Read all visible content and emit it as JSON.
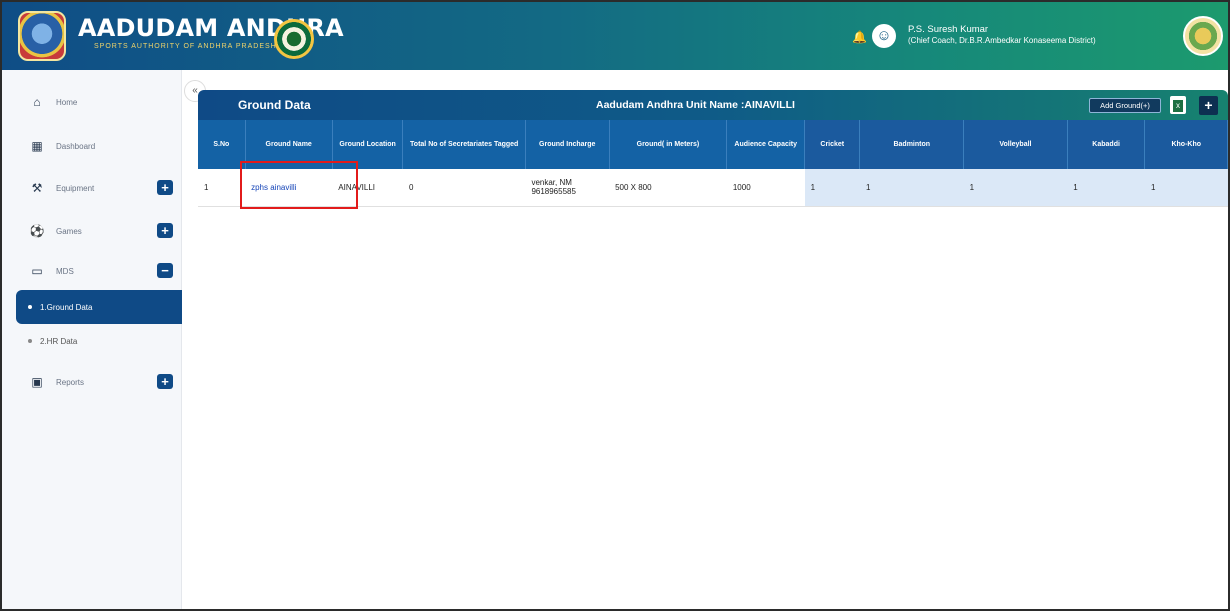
{
  "header": {
    "brand_title": "AADUDAM ANDHRA",
    "brand_subtitle": "SPORTS AUTHORITY OF ANDHRA PRADESH",
    "user_name": "P.S. Suresh Kumar",
    "user_role": "(Chief Coach, Dr.B.R.Ambedkar Konaseema District)"
  },
  "sidebar": {
    "collapse_glyph": "«",
    "items": [
      {
        "label": "Home",
        "icon": "home-icon"
      },
      {
        "label": "Dashboard",
        "icon": "dashboard-icon"
      },
      {
        "label": "Equipment",
        "icon": "equipment-icon",
        "toggle": "+"
      },
      {
        "label": "Games",
        "icon": "games-icon",
        "toggle": "+"
      },
      {
        "label": "MDS",
        "icon": "laptop-icon",
        "toggle": "−"
      },
      {
        "label": "Reports",
        "icon": "reports-icon",
        "toggle": "+"
      }
    ],
    "subitems": [
      {
        "label": "1.Ground Data",
        "active": true
      },
      {
        "label": "2.HR Data",
        "active": false
      }
    ]
  },
  "content": {
    "title": "Ground Data",
    "unit_name": "Aadudam Andhra Unit Name :AINAVILLI",
    "add_ground_label": "Add Ground(+)"
  },
  "table": {
    "headers": [
      "S.No",
      "Ground Name",
      "Ground Location",
      "Total No of Secretariates Tagged",
      "Ground Incharge",
      "Ground( in Meters)",
      "Audience Capacity",
      "Cricket",
      "Badminton",
      "Volleyball",
      "Kabaddi",
      "Kho-Kho"
    ],
    "rows": [
      [
        "1",
        "zphs ainavilli",
        "AINAVILLI",
        "0",
        "venkar, NM 9618965585",
        "500 X 800",
        "1000",
        "1",
        "1",
        "1",
        "1",
        "1"
      ]
    ]
  },
  "colors": {
    "primary": "#0f4a86",
    "accent": "#17826f",
    "link": "#1645b8",
    "highlight": "#e21b1b"
  }
}
